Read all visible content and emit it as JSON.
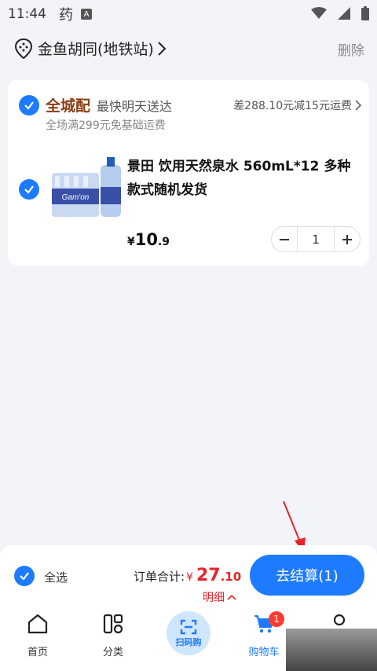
{
  "status_bar": {
    "time": "11:44",
    "app_indicator": "药",
    "a_icon": "A",
    "icons": [
      "wifi-icon",
      "signal-icon",
      "battery-icon"
    ]
  },
  "header": {
    "location": "金鱼胡同(地铁站)",
    "delete_label": "删除"
  },
  "store": {
    "name": "全城配",
    "delivery": "最快明天送达",
    "diff": "差288.10元减15元运费",
    "note": "全场满299元免基础运费"
  },
  "item": {
    "title": "景田 饮用天然泉水 560mL*12 多种款式随机发货",
    "price_yen": "¥",
    "price_int": "10",
    "price_dec": ".9",
    "quantity": "1",
    "brand_text": "Gam'on"
  },
  "checkout": {
    "select_all": "全选",
    "total_label": "订单合计:",
    "total_yen": "¥",
    "total_int": "27",
    "total_dec": ".10",
    "detail": "明细",
    "button": "去结算(1)"
  },
  "tabs": [
    {
      "label": "首页",
      "icon": "home-icon"
    },
    {
      "label": "分类",
      "icon": "category-icon"
    },
    {
      "label": "扫码购",
      "icon": "scan-icon"
    },
    {
      "label": "购物车",
      "icon": "cart-icon",
      "badge": "1"
    },
    {
      "label": "",
      "icon": "user-icon"
    }
  ],
  "colors": {
    "accent": "#1e7bff",
    "price": "#e8232b",
    "store_name": "#8b3d12",
    "background": "#f3f4f8"
  }
}
